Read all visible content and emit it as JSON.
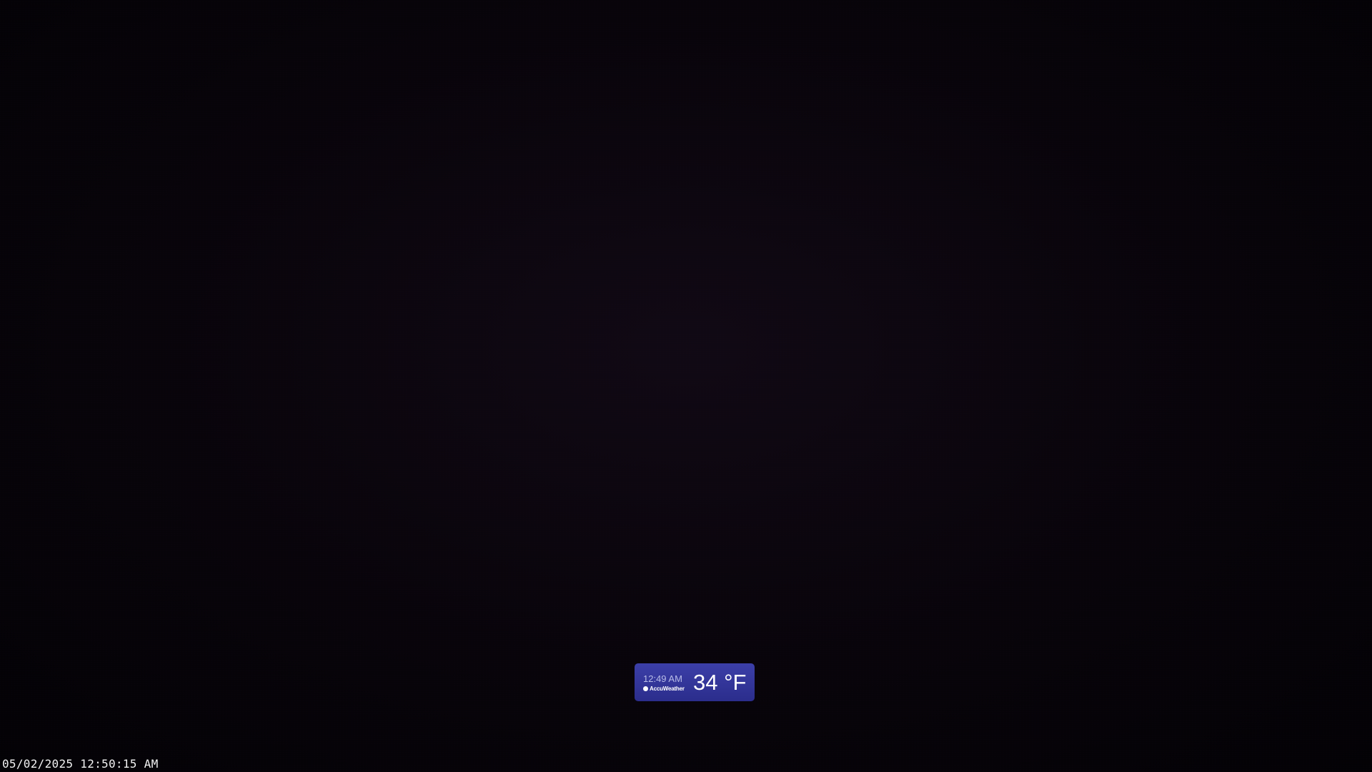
{
  "camera": {
    "timestamp": "05/02/2025 12:50:15 AM"
  },
  "weather_badge": {
    "time": "12:49 AM",
    "brand": "AccuWeather",
    "brand_icon": "accuweather-sun-icon",
    "temperature": "34 °F",
    "accent_color": "#2f318f"
  }
}
